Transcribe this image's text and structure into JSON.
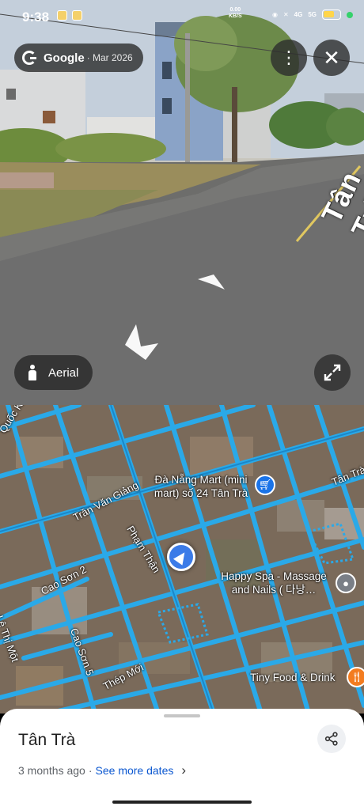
{
  "status_bar": {
    "time": "9:38",
    "net_speed_value": "0.00",
    "net_speed_unit": "KB/S",
    "signal_1": "4G",
    "signal_2": "5G",
    "battery": "97"
  },
  "street_view": {
    "brand": "Google",
    "capture_date": "· Mar 2026",
    "more_icon": "more-vert-icon",
    "close_icon": "close-icon",
    "aerial_label": "Aerial",
    "expand_icon": "expand-icon",
    "street_name_overlay": "Tân Trà"
  },
  "map": {
    "street_labels": [
      "Quốc Khải",
      "Trần Văn Giảng",
      "Phạm Thận",
      "Cao Sơn 2",
      "Cao Sơn 5",
      "Thép Mới",
      "Tân Trà",
      "Lê Thị Một"
    ],
    "pois": [
      {
        "name": "Đà Nẵng Mart (mini mart) số 24 Tân Trà",
        "color": "#1a73e8",
        "icon": "shopping-cart-icon"
      },
      {
        "name": "Happy Spa - Massage and Nails ( 다낭…",
        "color": "#7a7f87",
        "icon": "place-pin-icon"
      },
      {
        "name": "Tiny Food & Drink",
        "color": "#f37c20",
        "icon": "fork-knife-icon"
      }
    ],
    "road_color": "#2aa9e8",
    "marker_color": "#3b7be8"
  },
  "sheet": {
    "title": "Tân Trà",
    "age": "3 months ago",
    "separator": "·",
    "see_more": "See more dates",
    "share_icon": "share-icon"
  }
}
